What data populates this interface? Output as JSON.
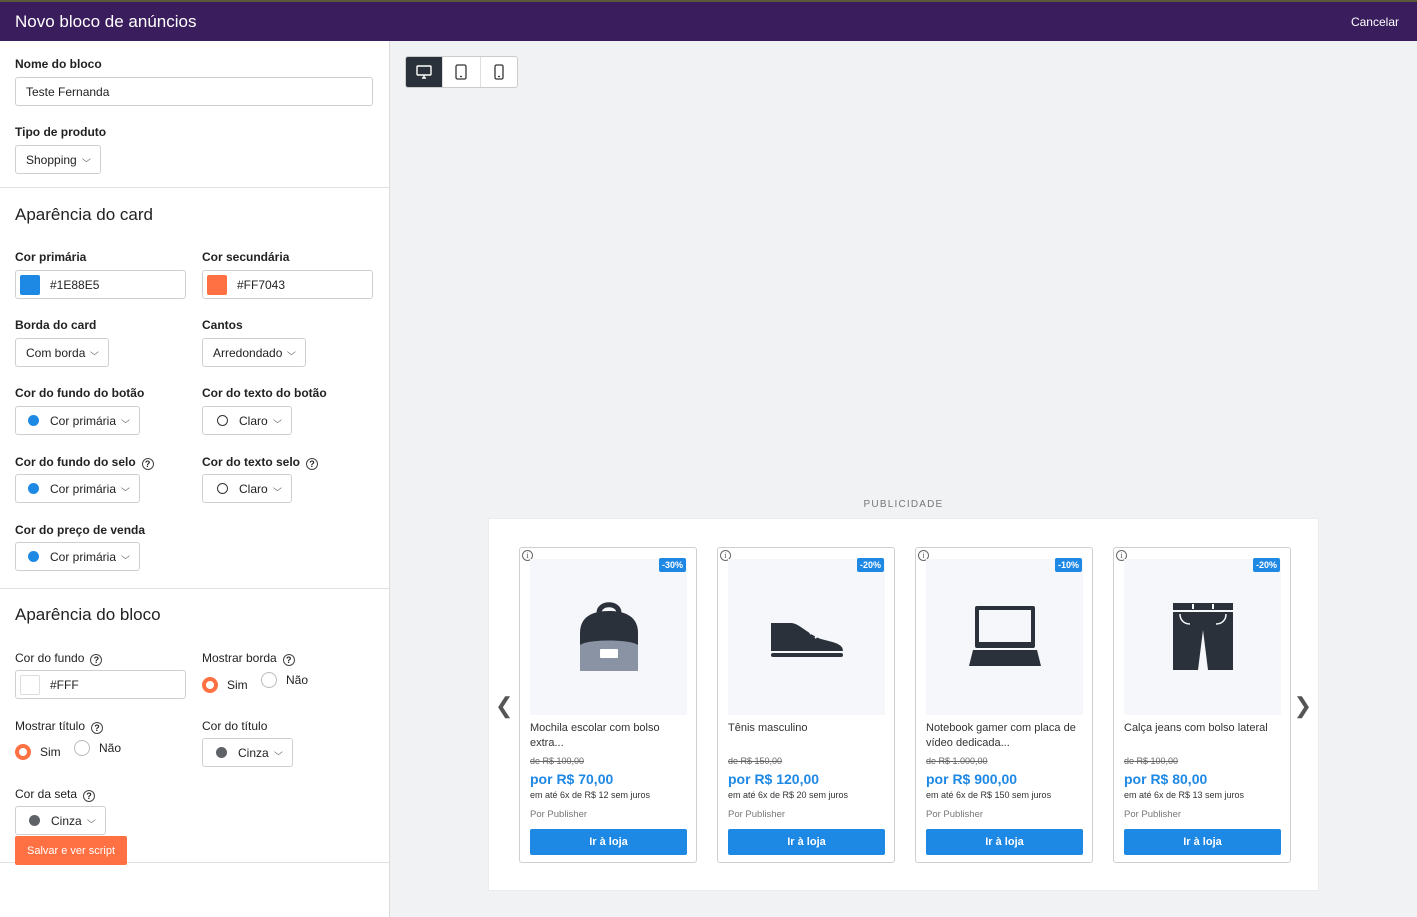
{
  "header": {
    "title": "Novo bloco de anúncios",
    "cancel_label": "Cancelar"
  },
  "form": {
    "block_name": {
      "label": "Nome do bloco",
      "value": "Teste Fernanda"
    },
    "product_type": {
      "label": "Tipo de produto",
      "value": "Shopping"
    },
    "card_section": {
      "title": "Aparência do card",
      "primary_color": {
        "label": "Cor primária",
        "value": "#1E88E5",
        "swatch": "#1E88E5"
      },
      "secondary_color": {
        "label": "Cor secundária",
        "value": "#FF7043",
        "swatch": "#FF7043"
      },
      "card_border": {
        "label": "Borda do card",
        "value": "Com borda"
      },
      "corners": {
        "label": "Cantos",
        "value": "Arredondado"
      },
      "button_bg": {
        "label": "Cor do fundo do botão",
        "value": "Cor primária"
      },
      "button_text": {
        "label": "Cor do texto do botão",
        "value": "Claro"
      },
      "seal_bg": {
        "label": "Cor do fundo do selo",
        "value": "Cor primária"
      },
      "seal_text": {
        "label": "Cor do texto selo",
        "value": "Claro"
      },
      "sale_price": {
        "label": "Cor do preço de venda",
        "value": "Cor primária"
      }
    },
    "block_section": {
      "title": "Aparência do bloco",
      "background": {
        "label": "Cor do fundo",
        "value": "#FFF"
      },
      "show_border": {
        "label": "Mostrar borda",
        "yes": "Sim",
        "no": "Não",
        "selected": "Sim"
      },
      "show_title": {
        "label": "Mostrar título",
        "yes": "Sim",
        "no": "Não",
        "selected": "Sim"
      },
      "title_color": {
        "label": "Cor do título",
        "value": "Cinza"
      },
      "arrow_color": {
        "label": "Cor da seta",
        "value": "Cinza"
      }
    },
    "save_label": "Salvar e ver script"
  },
  "preview": {
    "devices": [
      "desktop-icon",
      "tablet-icon",
      "mobile-icon"
    ],
    "active_device": "desktop",
    "ad_label": "PUBLICIDADE",
    "products": [
      {
        "icon": "backpack-icon",
        "badge": "-30%",
        "name": "Mochila escolar com bolso extra...",
        "old_price": "de R$ 100,00",
        "price": "por R$ 70,00",
        "installments": "em até 6x de R$ 12 sem juros",
        "publisher": "Por Publisher",
        "cta": "Ir à loja"
      },
      {
        "icon": "sneaker-icon",
        "badge": "-20%",
        "name": "Tênis masculino",
        "old_price": "de R$ 150,00",
        "price": "por R$ 120,00",
        "installments": "em até 6x de R$ 20 sem juros",
        "publisher": "Por Publisher",
        "cta": "Ir à loja"
      },
      {
        "icon": "laptop-icon",
        "badge": "-10%",
        "name": "Notebook gamer com placa de vídeo dedicada...",
        "old_price": "de R$ 1.000,00",
        "price": "por R$ 900,00",
        "installments": "em até 6x de R$ 150 sem juros",
        "publisher": "Por Publisher",
        "cta": "Ir à loja"
      },
      {
        "icon": "jeans-icon",
        "badge": "-20%",
        "name": "Calça jeans com bolso lateral",
        "old_price": "de R$ 100,00",
        "price": "por R$ 80,00",
        "installments": "em até 6x de R$ 13 sem juros",
        "publisher": "Por Publisher",
        "cta": "Ir à loja"
      }
    ]
  },
  "colors": {
    "header_bg": "#3A1D5C",
    "primary": "#1E88E5",
    "accent": "#FF7043",
    "icon_dark": "#2B313B"
  }
}
